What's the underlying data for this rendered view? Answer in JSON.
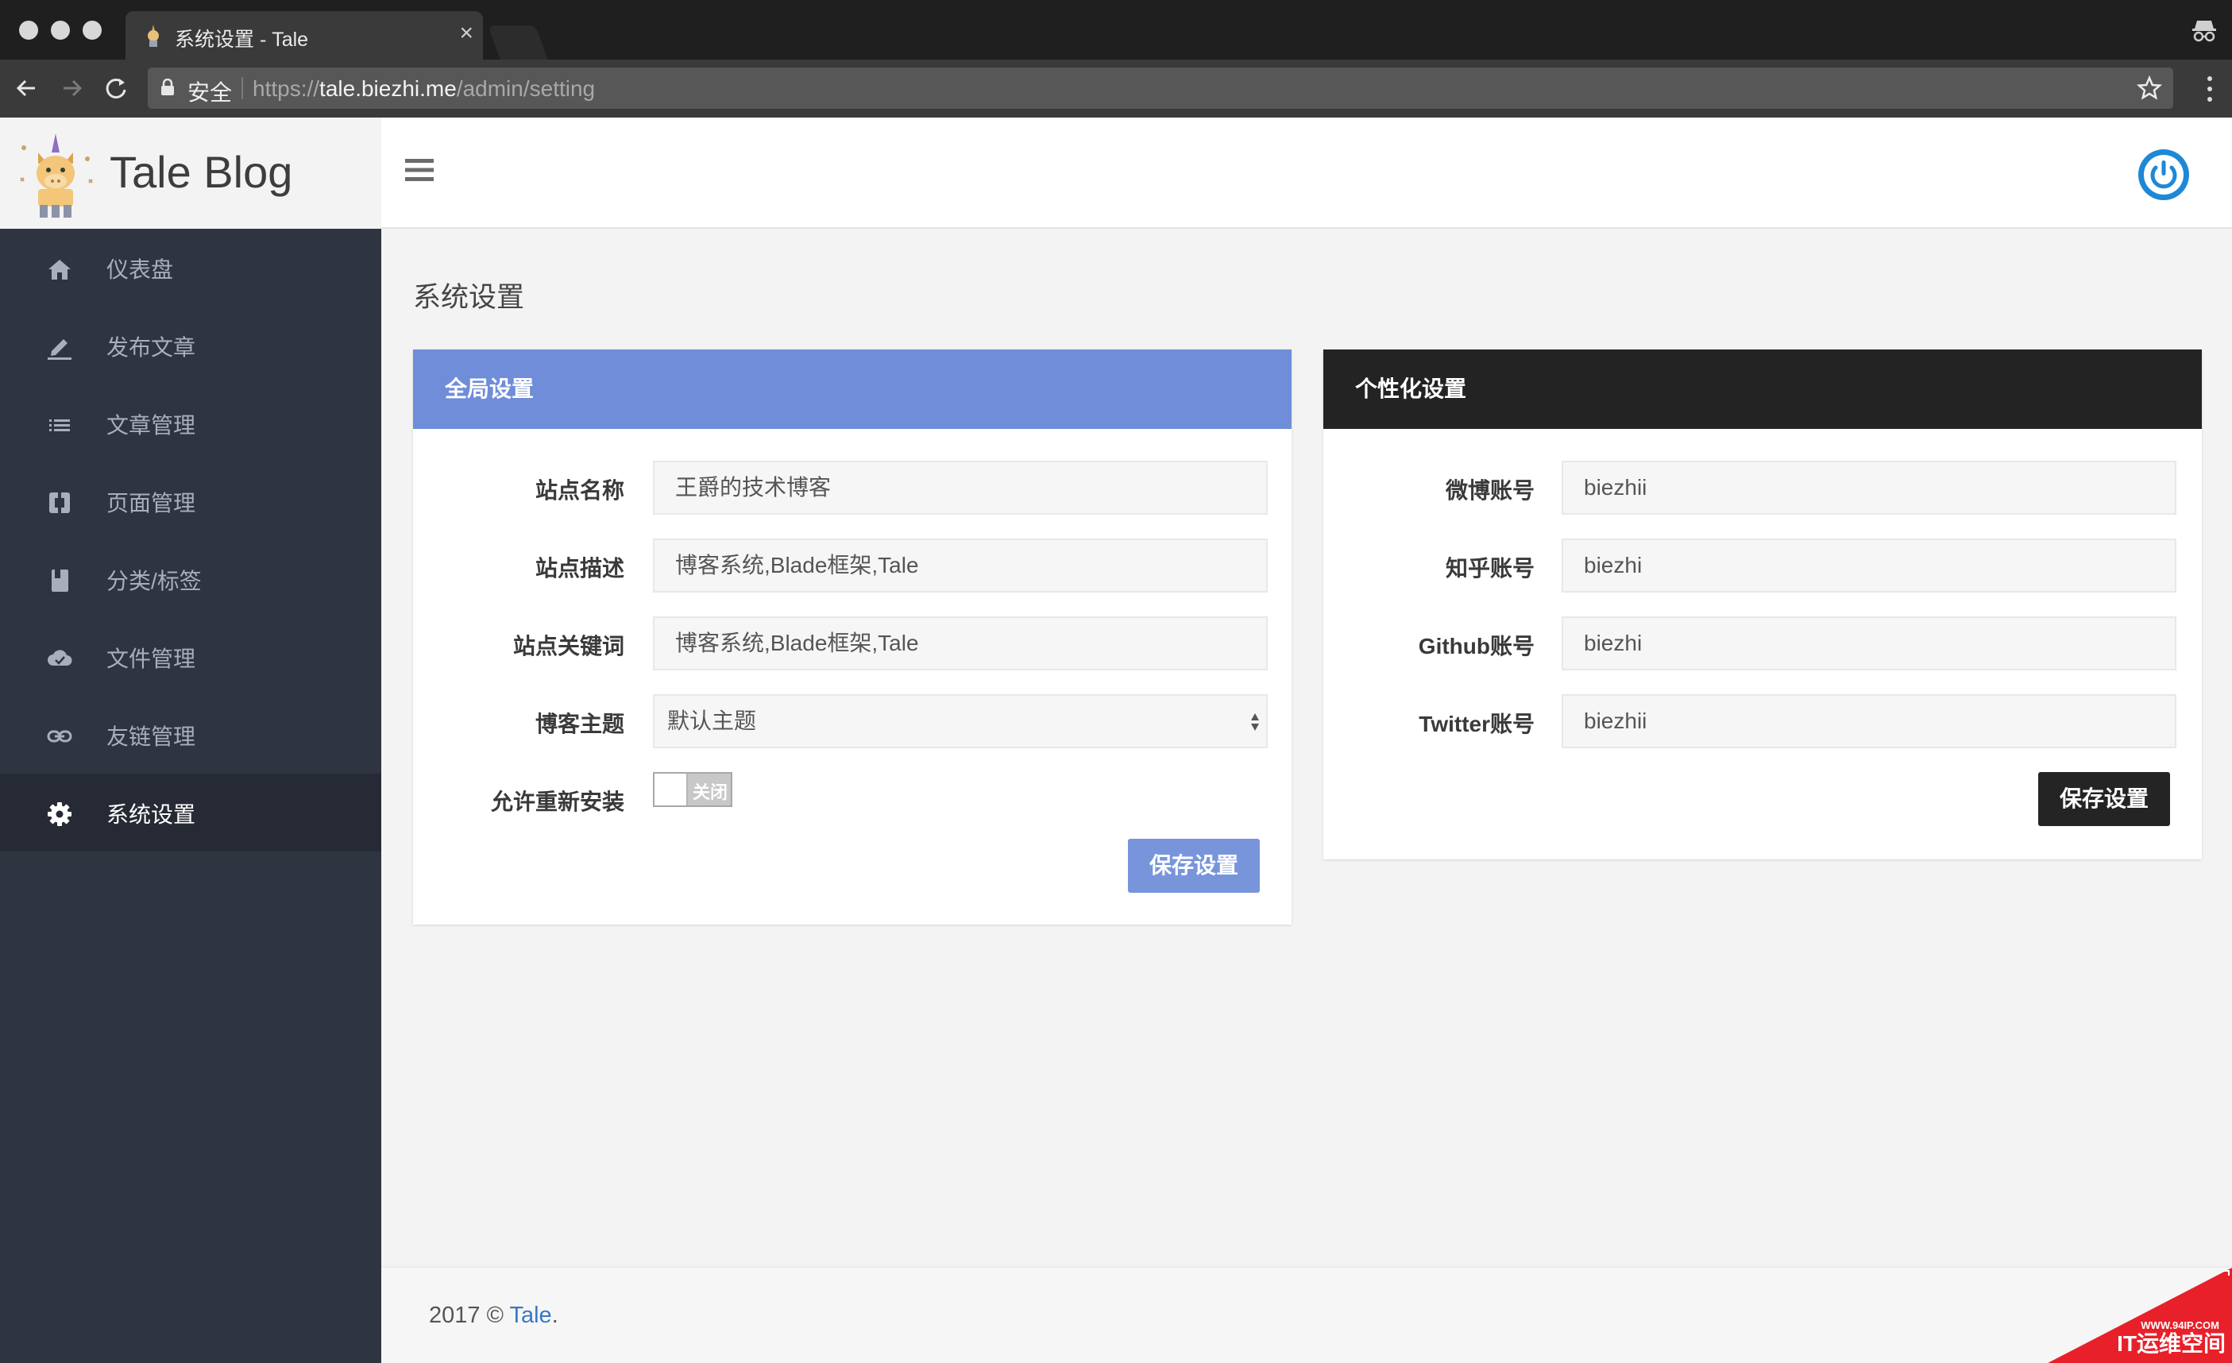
{
  "browser": {
    "tab_title": "系统设置 - Tale",
    "tab_close": "×",
    "secure_label": "安全",
    "url_scheme": "https://",
    "url_host": "tale.biezhi.me",
    "url_path": "/admin/setting"
  },
  "brand": {
    "name": "Tale Blog"
  },
  "sidebar": {
    "items": [
      {
        "label": "仪表盘",
        "icon": "home-icon"
      },
      {
        "label": "发布文章",
        "icon": "pencil-icon"
      },
      {
        "label": "文章管理",
        "icon": "list-icon"
      },
      {
        "label": "页面管理",
        "icon": "pages-icon"
      },
      {
        "label": "分类/标签",
        "icon": "book-icon"
      },
      {
        "label": "文件管理",
        "icon": "cloud-icon"
      },
      {
        "label": "友链管理",
        "icon": "link-icon"
      },
      {
        "label": "系统设置",
        "icon": "gear-icon",
        "active": true
      }
    ]
  },
  "page": {
    "title": "系统设置"
  },
  "global_settings": {
    "heading": "全局设置",
    "site_name_label": "站点名称",
    "site_name_value": "王爵的技术博客",
    "site_desc_label": "站点描述",
    "site_desc_value": "博客系统,Blade框架,Tale",
    "site_keywords_label": "站点关键词",
    "site_keywords_value": "博客系统,Blade框架,Tale",
    "theme_label": "博客主题",
    "theme_value": "默认主题",
    "reinstall_label": "允许重新安装",
    "reinstall_toggle": "关闭",
    "save_label": "保存设置"
  },
  "personal_settings": {
    "heading": "个性化设置",
    "weibo_label": "微博账号",
    "weibo_value": "biezhii",
    "zhihu_label": "知乎账号",
    "zhihu_value": "biezhi",
    "github_label": "Github账号",
    "github_value": "biezhi",
    "twitter_label": "Twitter账号",
    "twitter_value": "biezhii",
    "save_label": "保存设置"
  },
  "footer": {
    "text": "2017 © ",
    "link": "Tale",
    "suffix": "."
  },
  "watermark": {
    "site": "WWW.94IP.COM",
    "text": "IT运维空间"
  },
  "colors": {
    "sidebar_bg": "#2f3441",
    "global_header": "#6f8dd8",
    "personal_header": "#232323",
    "power_icon": "#1e88d6",
    "link": "#3a78c3"
  }
}
